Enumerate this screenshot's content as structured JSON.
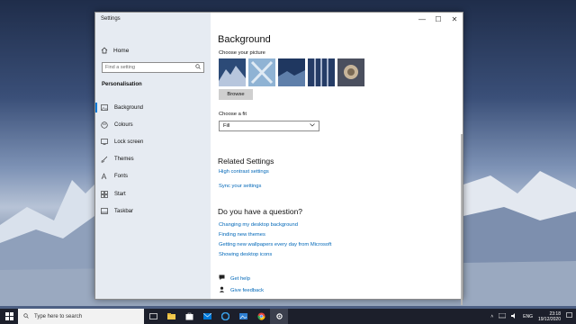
{
  "window": {
    "app_title": "Settings",
    "controls": {
      "minimize": "—",
      "maximize": "☐",
      "close": "✕"
    }
  },
  "sidebar": {
    "home_label": "Home",
    "search_placeholder": "Find a setting",
    "section_title": "Personalisation",
    "items": [
      {
        "label": "Background",
        "icon": "picture-icon",
        "active": true
      },
      {
        "label": "Colours",
        "icon": "palette-icon",
        "active": false
      },
      {
        "label": "Lock screen",
        "icon": "lock-screen-icon",
        "active": false
      },
      {
        "label": "Themes",
        "icon": "brush-icon",
        "active": false
      },
      {
        "label": "Fonts",
        "icon": "font-icon",
        "active": false
      },
      {
        "label": "Start",
        "icon": "start-icon",
        "active": false
      },
      {
        "label": "Taskbar",
        "icon": "taskbar-icon",
        "active": false
      }
    ]
  },
  "main": {
    "title": "Background",
    "choose_picture_label": "Choose your picture",
    "browse_label": "Browse",
    "choose_fit_label": "Choose a fit",
    "fit_value": "Fill",
    "related_title": "Related Settings",
    "related_links": [
      "High contrast settings",
      "Sync your settings"
    ],
    "question_title": "Do you have a question?",
    "question_links": [
      "Changing my desktop background",
      "Finding new themes",
      "Getting new wallpapers every day from Microsoft",
      "Showing desktop icons"
    ],
    "help_links": [
      {
        "label": "Get help",
        "icon": "chat-help-icon"
      },
      {
        "label": "Give feedback",
        "icon": "feedback-icon"
      }
    ]
  },
  "taskbar": {
    "search_placeholder": "Type here to search",
    "pinned": [
      "task-view-icon",
      "file-explorer-icon",
      "store-icon",
      "mail-icon",
      "edge-icon",
      "photos-icon",
      "chrome-icon",
      "settings-icon"
    ],
    "tray": {
      "language": "ENG",
      "time": "23:18",
      "date": "19/12/2020"
    }
  },
  "colors": {
    "accent": "#0078d7",
    "link": "#0067b8"
  }
}
